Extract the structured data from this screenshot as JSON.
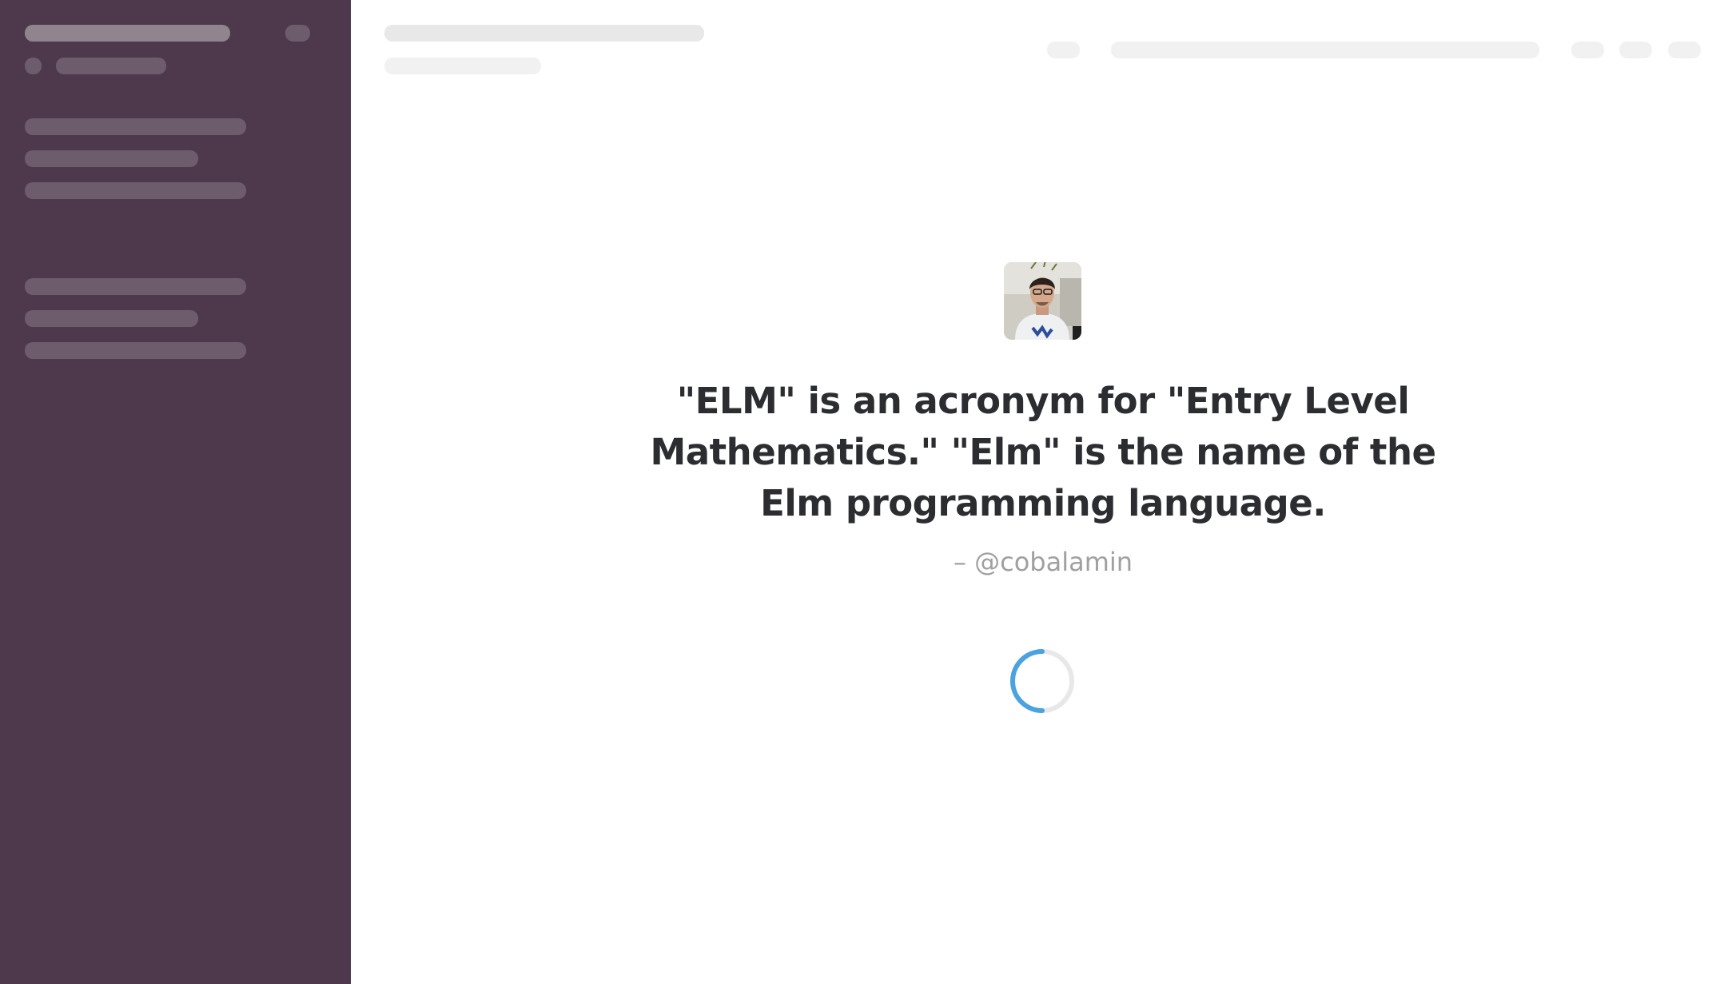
{
  "loading_screen": {
    "quote": "\"ELM\" is an acronym for \"Entry Level Mathematics.\" \"Elm\" is the name of the Elm programming language.",
    "attribution": "– @cobalamin"
  },
  "colors": {
    "sidebar_bg": "#4d394b",
    "spinner_accent": "#4aa3df",
    "quote_text": "#2c2d30",
    "attribution_text": "#a0a0a2"
  },
  "icons": {
    "spinner": "loading-spinner-icon",
    "avatar": "user-avatar"
  }
}
